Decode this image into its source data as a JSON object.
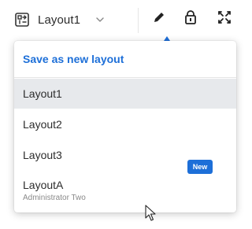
{
  "toolbar": {
    "current_layout": "Layout1",
    "icons": {
      "layout": "layout-icon",
      "dropdown": "chevron-down-icon",
      "edit": "pencil-icon",
      "lock": "lock-icon",
      "fit": "fit-to-screen-icon"
    }
  },
  "menu": {
    "save_label": "Save as new layout",
    "items": [
      {
        "label": "Layout1",
        "selected": true
      },
      {
        "label": "Layout2"
      },
      {
        "label": "Layout3"
      },
      {
        "label": "LayoutA",
        "sublabel": "Administrator Two",
        "badge": "New"
      }
    ]
  },
  "colors": {
    "accent": "#1d6fd8",
    "selected_bg": "#e7e9ec"
  }
}
